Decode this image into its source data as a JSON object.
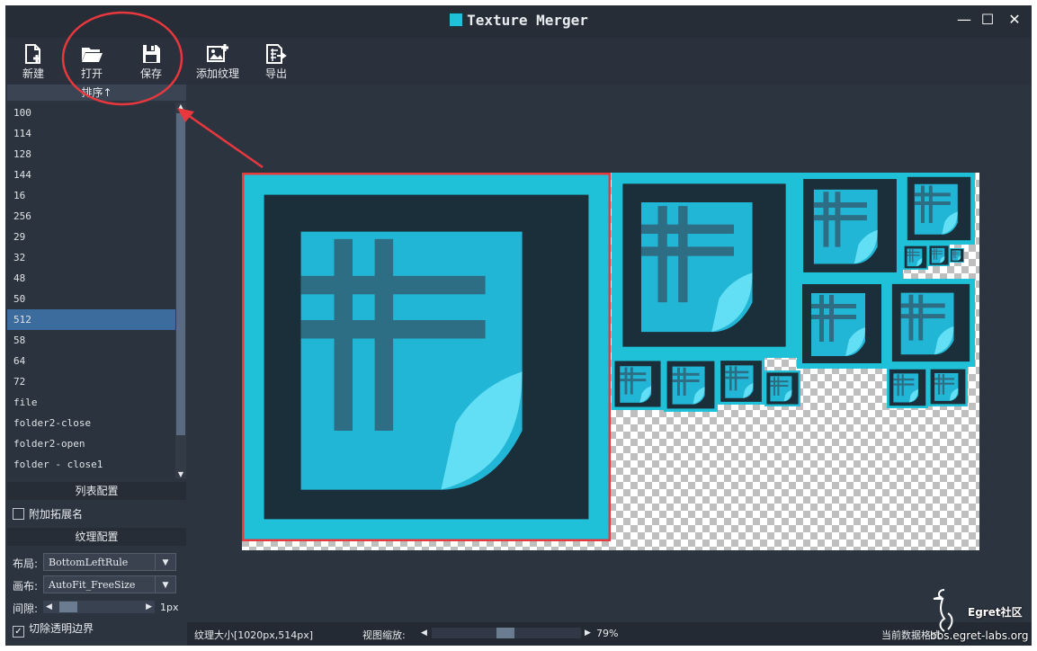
{
  "window": {
    "title": "Texture Merger",
    "controls": {
      "minimize": "—",
      "maximize": "☐",
      "close": "✕"
    }
  },
  "toolbar": {
    "new_label": "新建",
    "open_label": "打开",
    "save_label": "保存",
    "add_texture_label": "添加纹理",
    "export_label": "导出"
  },
  "sidebar": {
    "sort_header": "排序↑",
    "items": [
      "100",
      "114",
      "128",
      "144",
      "16",
      "256",
      "29",
      "32",
      "48",
      "50",
      "512",
      "58",
      "64",
      "72",
      "file",
      "folder2-close",
      "folder2-open",
      "folder - close1"
    ],
    "selected_item": "512",
    "list_config_header": "列表配置",
    "append_extension_label": "附加拓展名",
    "append_extension_checked": false,
    "texture_config_header": "纹理配置",
    "layout_label": "布局:",
    "layout_value": "BottomLeftRule",
    "canvas_label": "画布:",
    "canvas_value": "AutoFit_FreeSize",
    "gap_label": "间隙:",
    "gap_value": "1px",
    "trim_label": "切除透明边界",
    "trim_checked": true
  },
  "status": {
    "texture_size": "纹理大小[1020px,514px]",
    "zoom_label": "视图缩放:",
    "zoom_value": "79%",
    "current_data": "当前数据格式"
  },
  "watermark": {
    "brand": "Egret社区",
    "url": "bbs.egret-labs.org"
  },
  "colors": {
    "accent": "#1fc1d8",
    "selection": "#3c6b9e",
    "annotation": "#e8383d"
  },
  "icons": {
    "new": "new-file-icon",
    "open": "folder-open-icon",
    "save": "floppy-disk-icon",
    "add_texture": "add-image-icon",
    "export": "export-icon"
  }
}
